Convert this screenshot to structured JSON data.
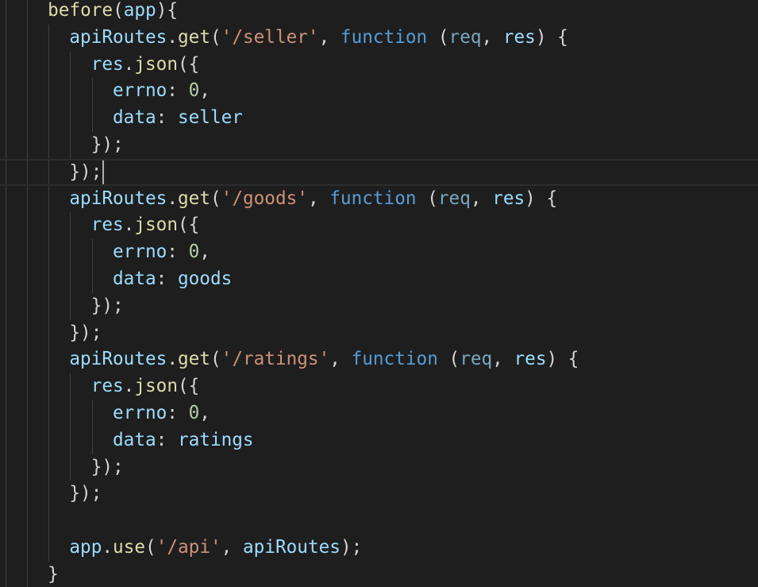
{
  "editor": {
    "lines": [
      {
        "indent": 2,
        "tokens": [
          {
            "t": "before",
            "c": "fn"
          },
          {
            "t": "(",
            "c": "punc"
          },
          {
            "t": "app",
            "c": "var"
          },
          {
            "t": "){",
            "c": "punc"
          }
        ]
      },
      {
        "indent": 3,
        "tokens": [
          {
            "t": "apiRoutes",
            "c": "var"
          },
          {
            "t": ".",
            "c": "punc"
          },
          {
            "t": "get",
            "c": "fn"
          },
          {
            "t": "(",
            "c": "punc"
          },
          {
            "t": "'/seller'",
            "c": "str"
          },
          {
            "t": ", ",
            "c": "punc"
          },
          {
            "t": "function",
            "c": "kw"
          },
          {
            "t": " (",
            "c": "punc"
          },
          {
            "t": "req",
            "c": "param"
          },
          {
            "t": ", ",
            "c": "punc"
          },
          {
            "t": "res",
            "c": "var"
          },
          {
            "t": ") {",
            "c": "punc"
          }
        ]
      },
      {
        "indent": 4,
        "tokens": [
          {
            "t": "res",
            "c": "var"
          },
          {
            "t": ".",
            "c": "punc"
          },
          {
            "t": "json",
            "c": "fn"
          },
          {
            "t": "({",
            "c": "punc"
          }
        ]
      },
      {
        "indent": 5,
        "tokens": [
          {
            "t": "errno",
            "c": "var"
          },
          {
            "t": ": ",
            "c": "punc"
          },
          {
            "t": "0",
            "c": "num"
          },
          {
            "t": ",",
            "c": "punc"
          }
        ]
      },
      {
        "indent": 5,
        "tokens": [
          {
            "t": "data",
            "c": "var"
          },
          {
            "t": ": ",
            "c": "punc"
          },
          {
            "t": "seller",
            "c": "var"
          }
        ]
      },
      {
        "indent": 4,
        "tokens": [
          {
            "t": "});",
            "c": "punc"
          }
        ]
      },
      {
        "indent": 3,
        "current": true,
        "tokens": [
          {
            "t": "});",
            "c": "punc"
          }
        ]
      },
      {
        "indent": 3,
        "tokens": [
          {
            "t": "apiRoutes",
            "c": "var"
          },
          {
            "t": ".",
            "c": "punc"
          },
          {
            "t": "get",
            "c": "fn"
          },
          {
            "t": "(",
            "c": "punc"
          },
          {
            "t": "'/goods'",
            "c": "str"
          },
          {
            "t": ", ",
            "c": "punc"
          },
          {
            "t": "function",
            "c": "kw"
          },
          {
            "t": " (",
            "c": "punc"
          },
          {
            "t": "req",
            "c": "param"
          },
          {
            "t": ", ",
            "c": "punc"
          },
          {
            "t": "res",
            "c": "var"
          },
          {
            "t": ") {",
            "c": "punc"
          }
        ]
      },
      {
        "indent": 4,
        "tokens": [
          {
            "t": "res",
            "c": "var"
          },
          {
            "t": ".",
            "c": "punc"
          },
          {
            "t": "json",
            "c": "fn"
          },
          {
            "t": "({",
            "c": "punc"
          }
        ]
      },
      {
        "indent": 5,
        "tokens": [
          {
            "t": "errno",
            "c": "var"
          },
          {
            "t": ": ",
            "c": "punc"
          },
          {
            "t": "0",
            "c": "num"
          },
          {
            "t": ",",
            "c": "punc"
          }
        ]
      },
      {
        "indent": 5,
        "tokens": [
          {
            "t": "data",
            "c": "var"
          },
          {
            "t": ": ",
            "c": "punc"
          },
          {
            "t": "goods",
            "c": "var"
          }
        ]
      },
      {
        "indent": 4,
        "tokens": [
          {
            "t": "});",
            "c": "punc"
          }
        ]
      },
      {
        "indent": 3,
        "tokens": [
          {
            "t": "});",
            "c": "punc"
          }
        ]
      },
      {
        "indent": 3,
        "tokens": [
          {
            "t": "apiRoutes",
            "c": "var"
          },
          {
            "t": ".",
            "c": "punc"
          },
          {
            "t": "get",
            "c": "fn"
          },
          {
            "t": "(",
            "c": "punc"
          },
          {
            "t": "'/ratings'",
            "c": "str"
          },
          {
            "t": ", ",
            "c": "punc"
          },
          {
            "t": "function",
            "c": "kw"
          },
          {
            "t": " (",
            "c": "punc"
          },
          {
            "t": "req",
            "c": "param"
          },
          {
            "t": ", ",
            "c": "punc"
          },
          {
            "t": "res",
            "c": "var"
          },
          {
            "t": ") {",
            "c": "punc"
          }
        ]
      },
      {
        "indent": 4,
        "tokens": [
          {
            "t": "res",
            "c": "var"
          },
          {
            "t": ".",
            "c": "punc"
          },
          {
            "t": "json",
            "c": "fn"
          },
          {
            "t": "({",
            "c": "punc"
          }
        ]
      },
      {
        "indent": 5,
        "tokens": [
          {
            "t": "errno",
            "c": "var"
          },
          {
            "t": ": ",
            "c": "punc"
          },
          {
            "t": "0",
            "c": "num"
          },
          {
            "t": ",",
            "c": "punc"
          }
        ]
      },
      {
        "indent": 5,
        "tokens": [
          {
            "t": "data",
            "c": "var"
          },
          {
            "t": ": ",
            "c": "punc"
          },
          {
            "t": "ratings",
            "c": "var"
          }
        ]
      },
      {
        "indent": 4,
        "tokens": [
          {
            "t": "});",
            "c": "punc"
          }
        ]
      },
      {
        "indent": 3,
        "tokens": [
          {
            "t": "});",
            "c": "punc"
          }
        ]
      },
      {
        "indent": 3,
        "tokens": []
      },
      {
        "indent": 3,
        "tokens": [
          {
            "t": "app",
            "c": "var"
          },
          {
            "t": ".",
            "c": "punc"
          },
          {
            "t": "use",
            "c": "fn"
          },
          {
            "t": "(",
            "c": "punc"
          },
          {
            "t": "'/api'",
            "c": "str"
          },
          {
            "t": ", ",
            "c": "punc"
          },
          {
            "t": "apiRoutes",
            "c": "var"
          },
          {
            "t": ");",
            "c": "punc"
          }
        ]
      },
      {
        "indent": 2,
        "tokens": [
          {
            "t": "}",
            "c": "punc"
          }
        ]
      }
    ]
  },
  "theme": {
    "background": "#1e1e1e",
    "function": "#dcdcaa",
    "variable": "#9cdcfe",
    "string": "#ce9178",
    "keyword": "#569cd6",
    "number": "#b5cea8",
    "punctuation": "#d4d4d4"
  }
}
